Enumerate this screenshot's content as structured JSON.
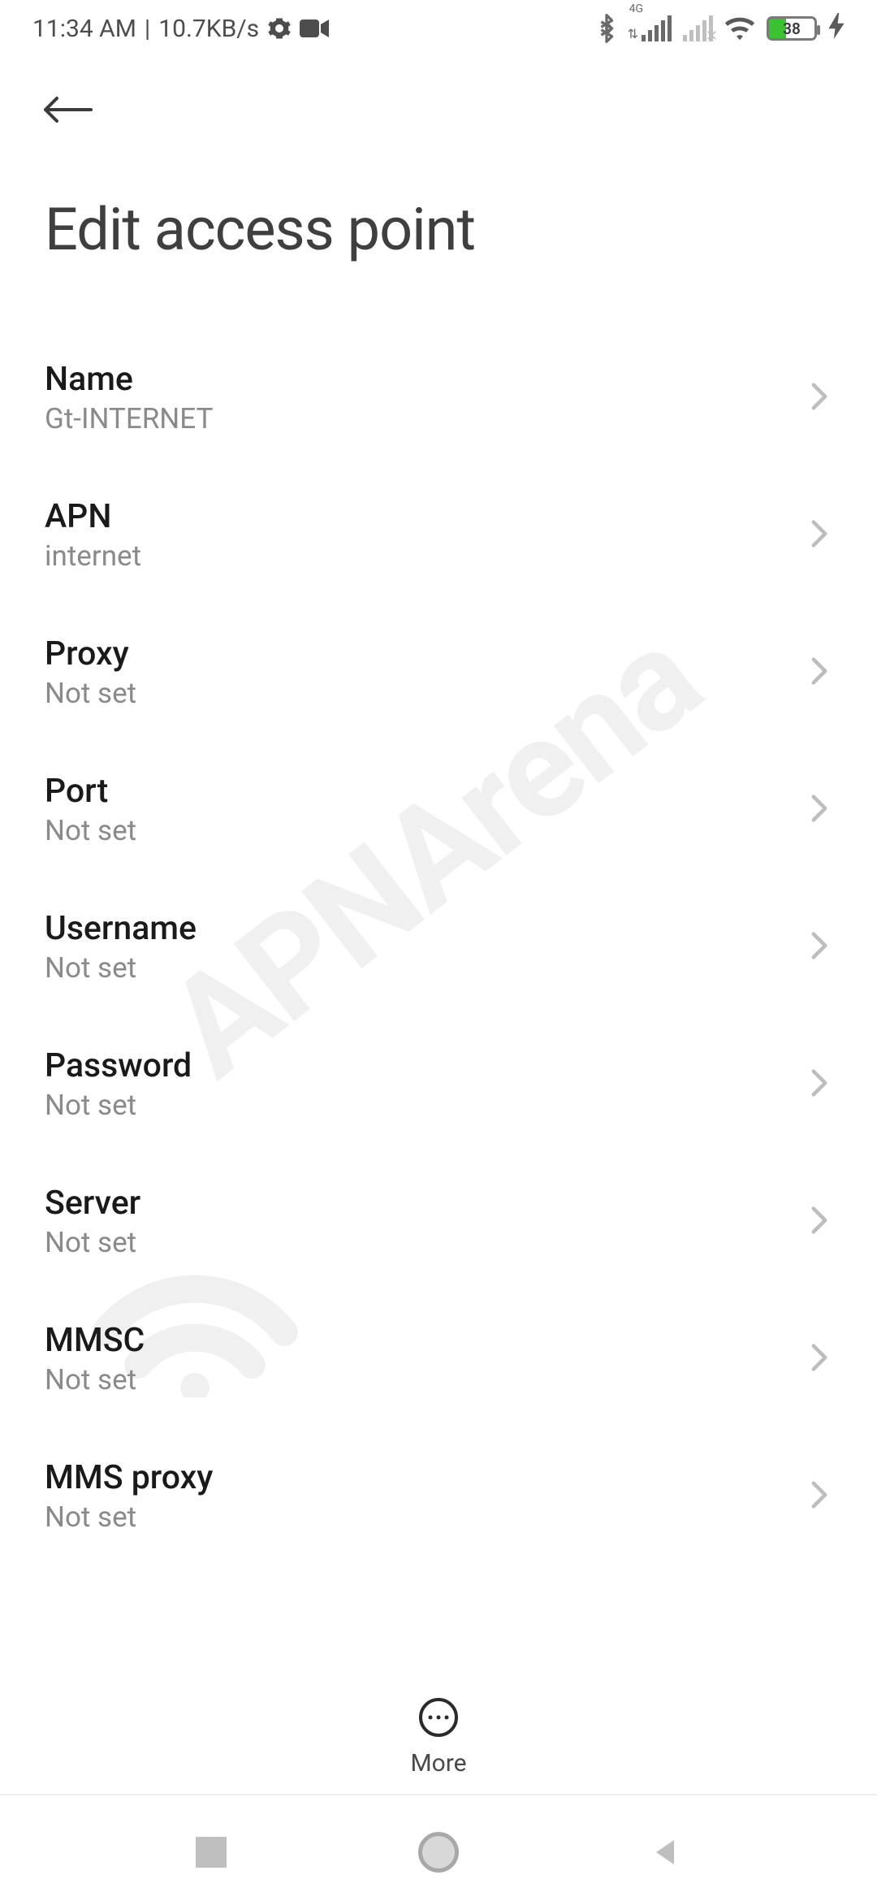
{
  "status": {
    "time": "11:34 AM",
    "speed": "10.7KB/s",
    "sig_label": "4G",
    "battery_pct": "38"
  },
  "header": {
    "title": "Edit access point"
  },
  "rows": [
    {
      "label": "Name",
      "value": "Gt-INTERNET"
    },
    {
      "label": "APN",
      "value": "internet"
    },
    {
      "label": "Proxy",
      "value": "Not set"
    },
    {
      "label": "Port",
      "value": "Not set"
    },
    {
      "label": "Username",
      "value": "Not set"
    },
    {
      "label": "Password",
      "value": "Not set"
    },
    {
      "label": "Server",
      "value": "Not set"
    },
    {
      "label": "MMSC",
      "value": "Not set"
    },
    {
      "label": "MMS proxy",
      "value": "Not set"
    }
  ],
  "action": {
    "more": "More"
  },
  "watermark": "APNArena"
}
